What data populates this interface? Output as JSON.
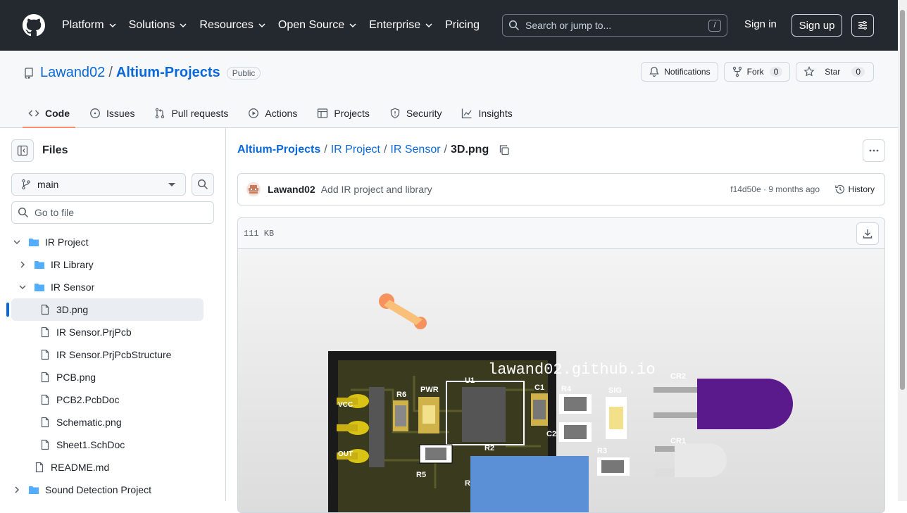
{
  "nav": {
    "items": [
      "Platform",
      "Solutions",
      "Resources",
      "Open Source",
      "Enterprise",
      "Pricing"
    ],
    "search_placeholder": "Search or jump to...",
    "search_shortcut": "/",
    "sign_in": "Sign in",
    "sign_up": "Sign up"
  },
  "repo": {
    "owner": "Lawand02",
    "separator": "/",
    "name": "Altium-Projects",
    "visibility": "Public",
    "notifications_label": "Notifications",
    "fork_label": "Fork",
    "fork_count": "0",
    "star_label": "Star",
    "star_count": "0"
  },
  "tabs": [
    "Code",
    "Issues",
    "Pull requests",
    "Actions",
    "Projects",
    "Security",
    "Insights"
  ],
  "sidebar": {
    "title": "Files",
    "branch": "main",
    "goto_placeholder": "Go to file",
    "tree": [
      {
        "label": "IR Project",
        "type": "dir",
        "open": true,
        "depth": 0
      },
      {
        "label": "IR Library",
        "type": "dir",
        "open": false,
        "depth": 1
      },
      {
        "label": "IR Sensor",
        "type": "dir",
        "open": true,
        "depth": 1
      },
      {
        "label": "3D.png",
        "type": "file",
        "depth": 2,
        "selected": true
      },
      {
        "label": "IR Sensor.PrjPcb",
        "type": "file",
        "depth": 2
      },
      {
        "label": "IR Sensor.PrjPcbStructure",
        "type": "file",
        "depth": 2
      },
      {
        "label": "PCB.png",
        "type": "file",
        "depth": 2
      },
      {
        "label": "PCB2.PcbDoc",
        "type": "file",
        "depth": 2
      },
      {
        "label": "Schematic.png",
        "type": "file",
        "depth": 2
      },
      {
        "label": "Sheet1.SchDoc",
        "type": "file",
        "depth": 2
      },
      {
        "label": "README.md",
        "type": "file",
        "depth": 1
      },
      {
        "label": "Sound Detection Project",
        "type": "dir",
        "open": false,
        "depth": 0
      }
    ]
  },
  "breadcrumb": {
    "parts": [
      "Altium-Projects",
      "IR Project",
      "IR Sensor"
    ],
    "separator": "/",
    "current": "3D.png"
  },
  "commit": {
    "author": "Lawand02",
    "message": "Add IR project and library",
    "sha_time": "f14d50e · 9 months ago",
    "history_label": "History"
  },
  "file": {
    "size": "111 KB"
  },
  "pcb": {
    "silkscreen_url": "lawand02.github.io",
    "labels": {
      "cr2": "CR2",
      "cr1": "CR1",
      "r6": "R6",
      "pwr": "PWR",
      "u1": "U1",
      "c1": "C1",
      "r4": "R4",
      "sig": "SIG",
      "c2": "C2",
      "r2": "R2",
      "r3": "R3",
      "r5": "R5",
      "r1": "R",
      "vcc": "VCC",
      "out": "OUT"
    }
  },
  "colors": {
    "header_bg": "#24292f",
    "link": "#0969da",
    "tab_underline": "#fd8c73",
    "selected_bar": "#0969da"
  }
}
